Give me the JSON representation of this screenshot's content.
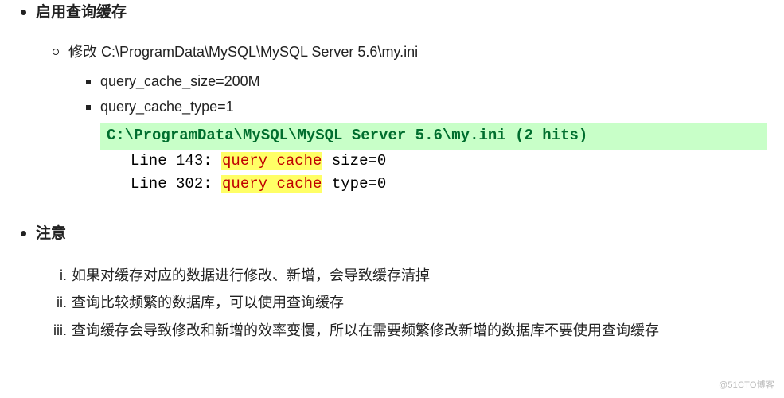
{
  "sections": [
    {
      "heading": "启用查询缓存",
      "subitems": [
        {
          "text": "修改 C:\\ProgramData\\MySQL\\MySQL Server 5.6\\my.ini",
          "bullets": [
            "query_cache_size=200M",
            "query_cache_type=1"
          ]
        }
      ],
      "code": {
        "header": "C:\\ProgramData\\MySQL\\MySQL Server 5.6\\my.ini (2 hits)",
        "lines": [
          {
            "prefix": "Line 143: ",
            "hl": "query_cache",
            "mid": "_",
            "tail": "size=0"
          },
          {
            "prefix": "Line 302: ",
            "hl": "query_cache",
            "mid": "_",
            "tail": "type=0"
          }
        ]
      }
    },
    {
      "heading": "注意",
      "notes": [
        {
          "roman": "i.",
          "text": "如果对缓存对应的数据进行修改、新增，会导致缓存清掉"
        },
        {
          "roman": "ii.",
          "text": "查询比较频繁的数据库，可以使用查询缓存"
        },
        {
          "roman": "iii.",
          "text": "查询缓存会导致修改和新增的效率变慢，所以在需要频繁修改新增的数据库不要使用查询缓存"
        }
      ]
    }
  ],
  "watermark": "@51CTO博客"
}
